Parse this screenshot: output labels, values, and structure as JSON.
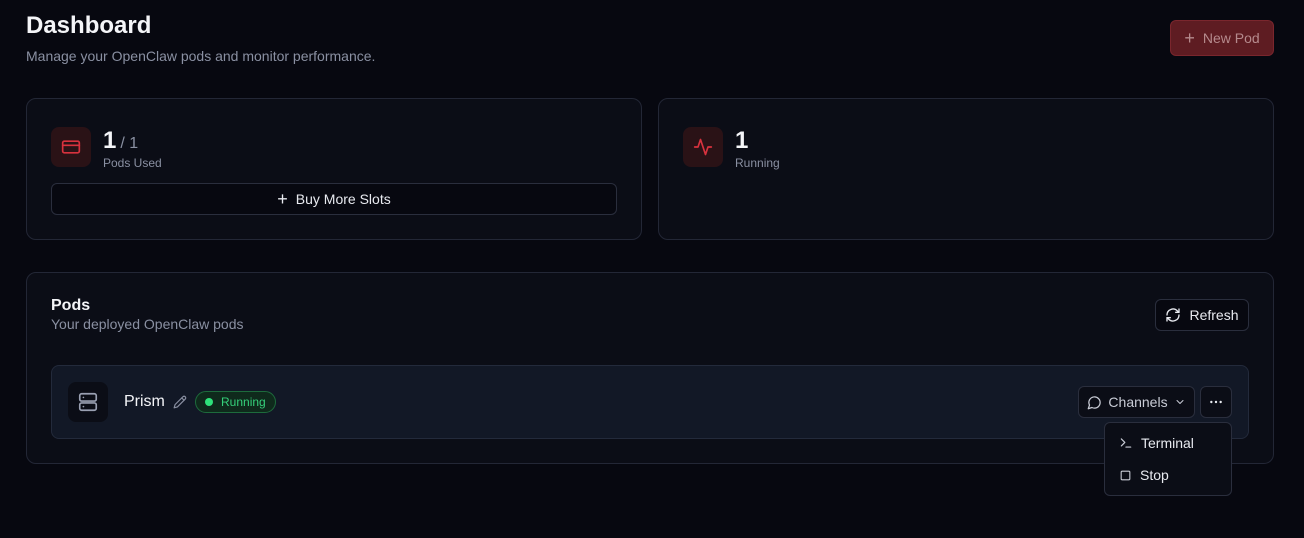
{
  "header": {
    "title": "Dashboard",
    "subtitle": "Manage your OpenClaw pods and monitor performance.",
    "new_pod_label": "New Pod"
  },
  "stats": {
    "pods_used": {
      "value": "1",
      "total": "/ 1",
      "label": "Pods Used",
      "icon": "card-icon"
    },
    "buy_more_label": "Buy More Slots",
    "running": {
      "value": "1",
      "label": "Running",
      "icon": "activity-icon"
    }
  },
  "pods": {
    "title": "Pods",
    "subtitle": "Your deployed OpenClaw pods",
    "refresh_label": "Refresh",
    "items": [
      {
        "name": "Prism",
        "status": "Running",
        "channels_label": "Channels"
      }
    ]
  },
  "menu": {
    "items": [
      {
        "label": "Terminal",
        "icon": "terminal-icon"
      },
      {
        "label": "Stop",
        "icon": "stop-icon"
      }
    ]
  },
  "colors": {
    "accent": "#c42b36",
    "running_green": "#2ee27a",
    "background": "#070810"
  }
}
